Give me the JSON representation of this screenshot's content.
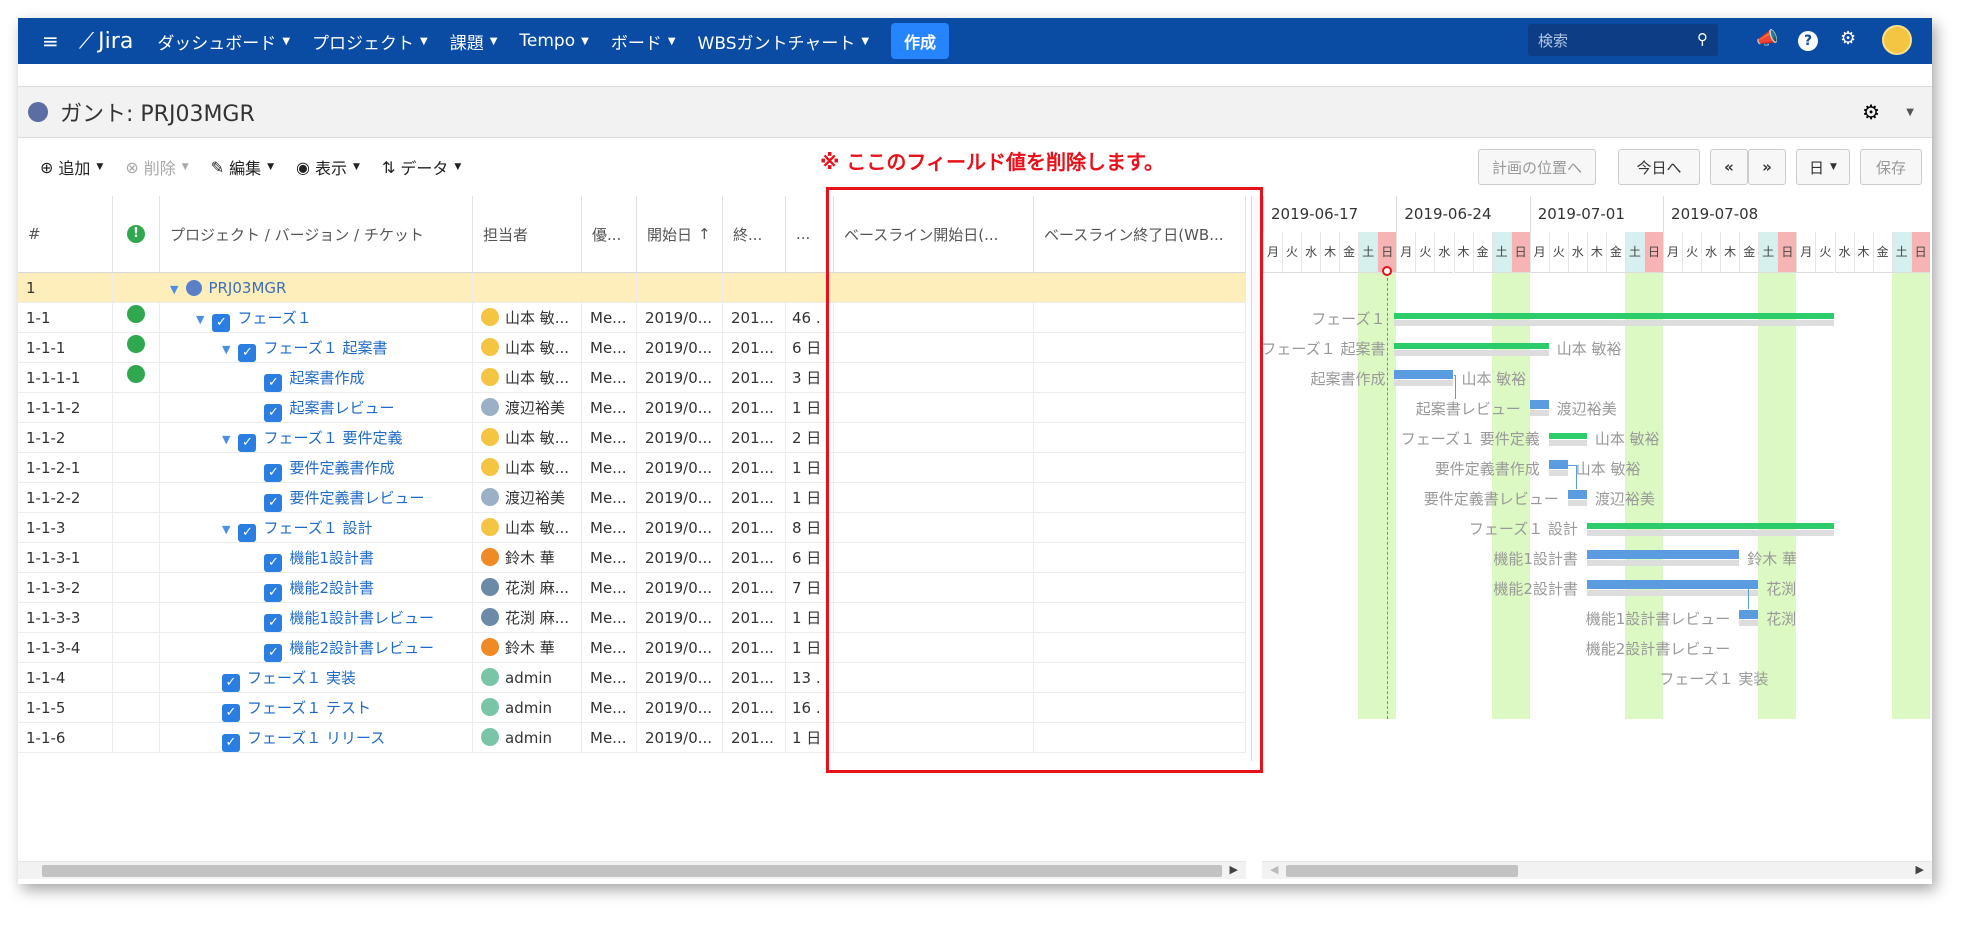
{
  "topnav": {
    "logo": "Jira",
    "menus": [
      "ダッシュボード",
      "プロジェクト",
      "課題",
      "Tempo",
      "ボード",
      "WBSガントチャート"
    ],
    "create_label": "作成",
    "search_placeholder": "検索"
  },
  "page": {
    "title": "ガント: PRJ03MGR"
  },
  "toolbar": {
    "add": "追加",
    "delete": "削除",
    "edit": "編集",
    "view": "表示",
    "data": "データ",
    "plan_position": "計画の位置へ",
    "today": "今日へ",
    "prev": "«",
    "next": "»",
    "scale": "日",
    "save": "保存"
  },
  "annotation": "※ ここのフィールド値を削除します。",
  "columns": [
    "#",
    "!",
    "プロジェクト / バージョン / チケット",
    "担当者",
    "優...",
    "開始日",
    "終...",
    "...",
    "ベースライン開始日(...",
    "ベースライン終了日(WB..."
  ],
  "rows": [
    {
      "num": "1",
      "warn": false,
      "name": "PRJ03MGR",
      "level": 0,
      "expand": true,
      "checkbox": false,
      "project": true,
      "assignee": "",
      "priority": "",
      "start": "",
      "end": "",
      "dur": ""
    },
    {
      "num": "1-1",
      "warn": true,
      "name": "フェーズ１",
      "level": 1,
      "expand": true,
      "checkbox": true,
      "assignee": "山本 敏...",
      "priority": "Me...",
      "start": "2019/0...",
      "end": "201...",
      "dur": "46 ."
    },
    {
      "num": "1-1-1",
      "warn": true,
      "name": "フェーズ１ 起案書",
      "level": 2,
      "expand": true,
      "checkbox": true,
      "assignee": "山本 敏...",
      "priority": "Me...",
      "start": "2019/0...",
      "end": "201...",
      "dur": "6 日"
    },
    {
      "num": "1-1-1-1",
      "warn": true,
      "name": "起案書作成",
      "level": 3,
      "expand": false,
      "checkbox": true,
      "assignee": "山本 敏...",
      "priority": "Me...",
      "start": "2019/0...",
      "end": "201...",
      "dur": "3 日"
    },
    {
      "num": "1-1-1-2",
      "warn": false,
      "name": "起案書レビュー",
      "level": 3,
      "expand": false,
      "checkbox": true,
      "assignee": "渡辺裕美",
      "priority": "Me...",
      "start": "2019/0...",
      "end": "201...",
      "dur": "1 日"
    },
    {
      "num": "1-1-2",
      "warn": false,
      "name": "フェーズ１ 要件定義",
      "level": 2,
      "expand": true,
      "checkbox": true,
      "assignee": "山本 敏...",
      "priority": "Me...",
      "start": "2019/0...",
      "end": "201...",
      "dur": "2 日"
    },
    {
      "num": "1-1-2-1",
      "warn": false,
      "name": "要件定義書作成",
      "level": 3,
      "expand": false,
      "checkbox": true,
      "assignee": "山本 敏...",
      "priority": "Me...",
      "start": "2019/0...",
      "end": "201...",
      "dur": "1 日"
    },
    {
      "num": "1-1-2-2",
      "warn": false,
      "name": "要件定義書レビュー",
      "level": 3,
      "expand": false,
      "checkbox": true,
      "assignee": "渡辺裕美",
      "priority": "Me...",
      "start": "2019/0...",
      "end": "201...",
      "dur": "1 日"
    },
    {
      "num": "1-1-3",
      "warn": false,
      "name": "フェーズ１ 設計",
      "level": 2,
      "expand": true,
      "checkbox": true,
      "assignee": "山本 敏...",
      "priority": "Me...",
      "start": "2019/0...",
      "end": "201...",
      "dur": "8 日"
    },
    {
      "num": "1-1-3-1",
      "warn": false,
      "name": "機能1設計書",
      "level": 3,
      "expand": false,
      "checkbox": true,
      "assignee": "鈴木 華",
      "priority": "Me...",
      "start": "2019/0...",
      "end": "201...",
      "dur": "6 日"
    },
    {
      "num": "1-1-3-2",
      "warn": false,
      "name": "機能2設計書",
      "level": 3,
      "expand": false,
      "checkbox": true,
      "assignee": "花渕 麻...",
      "priority": "Me...",
      "start": "2019/0...",
      "end": "201...",
      "dur": "7 日"
    },
    {
      "num": "1-1-3-3",
      "warn": false,
      "name": "機能1設計書レビュー",
      "level": 3,
      "expand": false,
      "checkbox": true,
      "assignee": "花渕 麻...",
      "priority": "Me...",
      "start": "2019/0...",
      "end": "201...",
      "dur": "1 日"
    },
    {
      "num": "1-1-3-4",
      "warn": false,
      "name": "機能2設計書レビュー",
      "level": 3,
      "expand": false,
      "checkbox": true,
      "assignee": "鈴木 華",
      "priority": "Me...",
      "start": "2019/0...",
      "end": "201...",
      "dur": "1 日"
    },
    {
      "num": "1-1-4",
      "warn": false,
      "name": "フェーズ１ 実装",
      "level": 2,
      "expand": false,
      "checkbox": true,
      "assignee": "admin",
      "priority": "Me...",
      "start": "2019/0...",
      "end": "201...",
      "dur": "13 ."
    },
    {
      "num": "1-1-5",
      "warn": false,
      "name": "フェーズ１ テスト",
      "level": 2,
      "expand": false,
      "checkbox": true,
      "assignee": "admin",
      "priority": "Me...",
      "start": "2019/0...",
      "end": "201...",
      "dur": "16 ."
    },
    {
      "num": "1-1-6",
      "warn": false,
      "name": "フェーズ１ リリース",
      "level": 2,
      "expand": false,
      "checkbox": true,
      "assignee": "admin",
      "priority": "Me...",
      "start": "2019/0...",
      "end": "201...",
      "dur": "1 日"
    }
  ],
  "gantt": {
    "weeks": [
      "2019-06-17",
      "2019-06-24",
      "2019-07-01",
      "2019-07-08"
    ],
    "weekdays": [
      "月",
      "火",
      "水",
      "木",
      "金",
      "土",
      "日"
    ],
    "bars": [
      {
        "task": "フェーズ１"
      },
      {
        "task": "フェーズ１ 起案書",
        "who": "山本 敏裕"
      },
      {
        "task": "起案書作成",
        "who": "山本 敏裕"
      },
      {
        "task": "起案書レビュー",
        "who": "渡辺裕美"
      },
      {
        "task": "フェーズ１ 要件定義",
        "who": "山本 敏裕"
      },
      {
        "task": "要件定義書作成",
        "who": "山本 敏裕"
      },
      {
        "task": "要件定義書レビュー",
        "who": "渡辺裕美"
      },
      {
        "task": "フェーズ１ 設計"
      },
      {
        "task": "機能1設計書",
        "who": "鈴木 華"
      },
      {
        "task": "機能2設計書",
        "who": "花渕"
      },
      {
        "task": "機能1設計書レビュー",
        "who": "花渕"
      },
      {
        "task": "機能2設計書レビュー"
      },
      {
        "task": "フェーズ１ 実装"
      }
    ]
  },
  "colors": {
    "nav": "#0a4ba4",
    "accent": "#2684ff",
    "annotation": "#e8111b",
    "phase_bar": "#2dcc6b",
    "task_bar": "#5b9be0",
    "holiday": "#d4f7b4"
  }
}
